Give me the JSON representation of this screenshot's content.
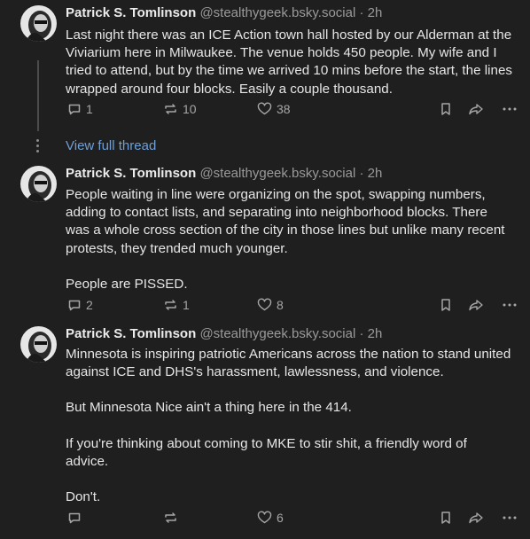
{
  "posts": [
    {
      "author_name": "Patrick S. Tomlinson",
      "handle": "@stealthygeek.bsky.social",
      "separator": "·",
      "time": "2h",
      "paragraphs": [
        "Last night there was an ICE Action town hall hosted by our Alderman at the Viviarium here in Milwaukee. The venue holds 450 people. My wife and I tried to attend, but by the time we arrived 10 mins before the start, the lines wrapped around four blocks. Easily a couple thousand."
      ],
      "replies": "1",
      "reposts": "10",
      "likes": "38"
    },
    {
      "author_name": "Patrick S. Tomlinson",
      "handle": "@stealthygeek.bsky.social",
      "separator": "·",
      "time": "2h",
      "paragraphs": [
        "People waiting in line were organizing on the spot, swapping numbers, adding to contact lists, and separating into neighborhood blocks. There was a whole cross section of the city in those lines but unlike many recent protests, they trended much younger.",
        "People are PISSED."
      ],
      "replies": "2",
      "reposts": "1",
      "likes": "8"
    },
    {
      "author_name": "Patrick S. Tomlinson",
      "handle": "@stealthygeek.bsky.social",
      "separator": "·",
      "time": "2h",
      "paragraphs": [
        "Minnesota is inspiring patriotic Americans across the nation to stand united against ICE and DHS's harassment, lawlessness, and violence.",
        "But Minnesota Nice ain't a thing here in the 414.",
        "If you're thinking about coming to MKE to stir shit, a friendly word of advice.",
        "Don't."
      ],
      "replies": "",
      "reposts": "",
      "likes": "6"
    }
  ],
  "view_full_thread": "View full thread",
  "icons": {
    "reply": "reply-icon",
    "repost": "repost-icon",
    "like": "heart-icon",
    "bookmark": "bookmark-icon",
    "share": "share-icon",
    "more": "more-icon"
  },
  "colors": {
    "background": "#1f1f1f",
    "link": "#6f9fd6",
    "muted": "#9a9a9a"
  }
}
